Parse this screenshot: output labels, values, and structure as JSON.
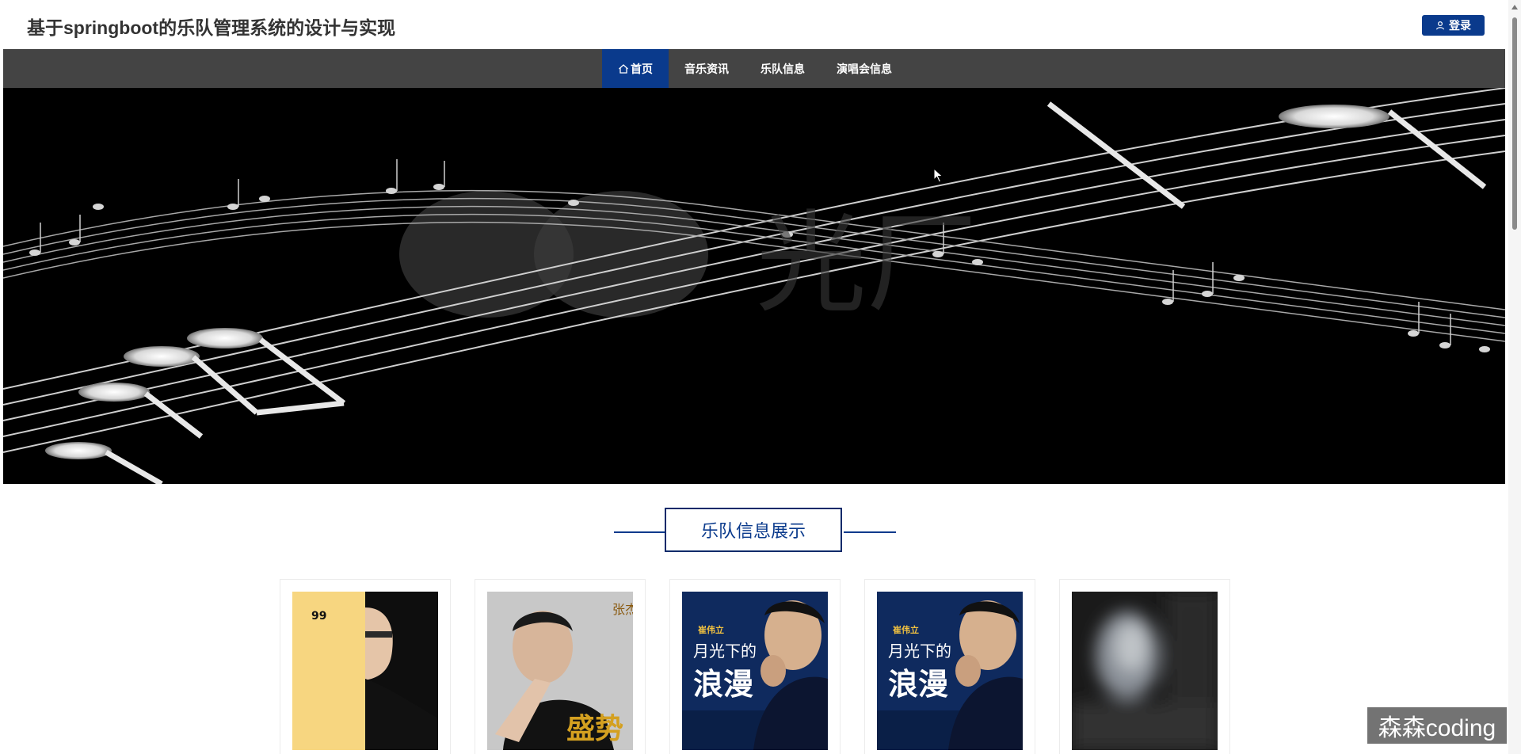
{
  "header": {
    "site_title": "基于springboot的乐队管理系统的设计与实现",
    "login_label": "登录"
  },
  "nav": {
    "items": [
      {
        "label": "首页",
        "active": true,
        "icon": "home-icon"
      },
      {
        "label": "音乐资讯",
        "active": false
      },
      {
        "label": "乐队信息",
        "active": false
      },
      {
        "label": "演唱会信息",
        "active": false
      }
    ]
  },
  "section": {
    "title": "乐队信息展示"
  },
  "cards": [
    {
      "cover": "yellow-portrait-cover"
    },
    {
      "cover": "zhang-jie-cover"
    },
    {
      "cover": "cui-weili-cover"
    },
    {
      "cover": "cui-weili-cover"
    },
    {
      "cover": "blurred-cover"
    }
  ],
  "album_text": {
    "zhangjie_name": "张杰",
    "zhangjie_title": "盛势",
    "cui_artist": "崔伟立",
    "cui_title_top": "月光下的",
    "cui_title_bottom": "浪漫"
  },
  "watermark": "森森coding",
  "colors": {
    "accent": "#0a3a8c",
    "nav_bg": "#444444",
    "banner_bg": "#000000"
  }
}
